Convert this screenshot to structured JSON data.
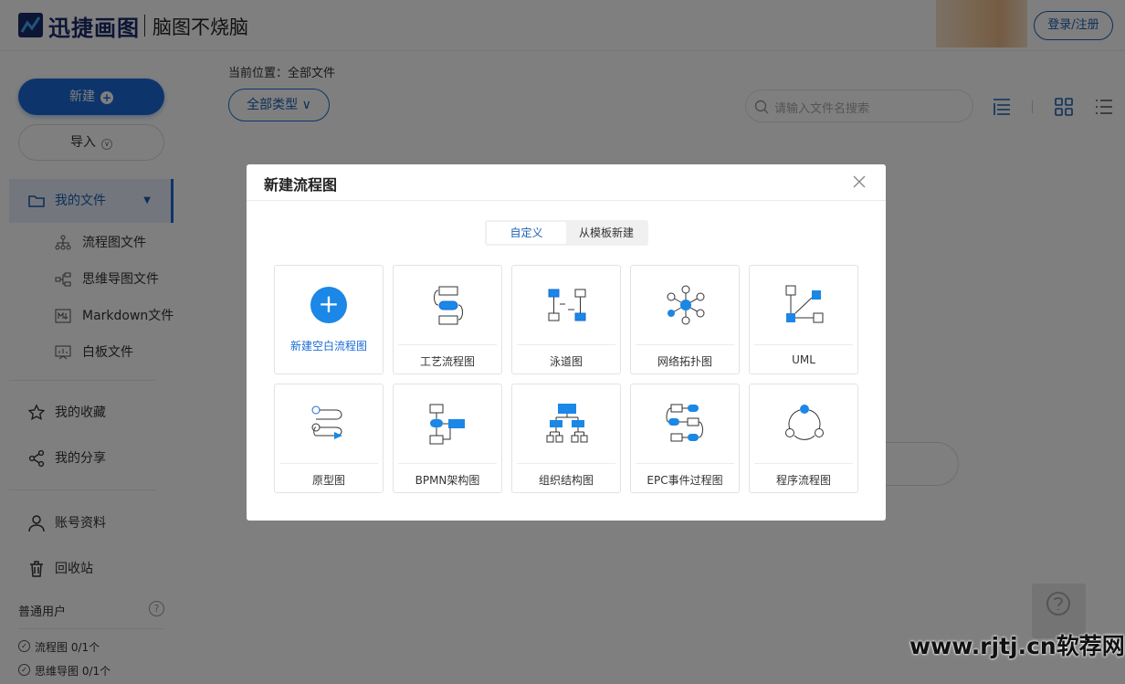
{
  "header": {
    "brand": "迅捷画图",
    "slogan": "脑图不烧脑",
    "login_label": "登录/注册"
  },
  "sidebar": {
    "new_label": "新建",
    "import_label": "导入",
    "my_files": "我的文件",
    "sub_items": [
      "流程图文件",
      "思维导图文件",
      "Markdown文件",
      "白板文件"
    ],
    "favorites": "我的收藏",
    "shares": "我的分享",
    "account": "账号资料",
    "trash": "回收站",
    "plan": "普通用户",
    "quotas": [
      "流程图 0/1个",
      "思维导图 0/1个"
    ]
  },
  "main": {
    "breadcrumb": "当前位置：全部文件",
    "type_filter": "全部类型",
    "search_placeholder": "请输入文件名搜索"
  },
  "modal": {
    "title": "新建流程图",
    "tabs": [
      "自定义",
      "从模板新建"
    ],
    "active_tab": "自定义",
    "blank_label": "新建空白流程图",
    "cards": [
      {
        "label": "工艺流程图",
        "icon": "process-flow-icon"
      },
      {
        "label": "泳道图",
        "icon": "swimlane-icon"
      },
      {
        "label": "网络拓扑图",
        "icon": "network-topology-icon"
      },
      {
        "label": "UML",
        "icon": "uml-icon"
      },
      {
        "label": "原型图",
        "icon": "prototype-icon"
      },
      {
        "label": "BPMN架构图",
        "icon": "bpmn-icon"
      },
      {
        "label": "组织结构图",
        "icon": "org-chart-icon"
      },
      {
        "label": "EPC事件过程图",
        "icon": "epc-icon"
      },
      {
        "label": "程序流程图",
        "icon": "program-flow-icon"
      }
    ]
  },
  "watermark": "www.rjtj.cn软荐网",
  "colors": {
    "brand": "#1b2a6b",
    "accent": "#1b6bd6",
    "icon_blue": "#1b87e6"
  }
}
